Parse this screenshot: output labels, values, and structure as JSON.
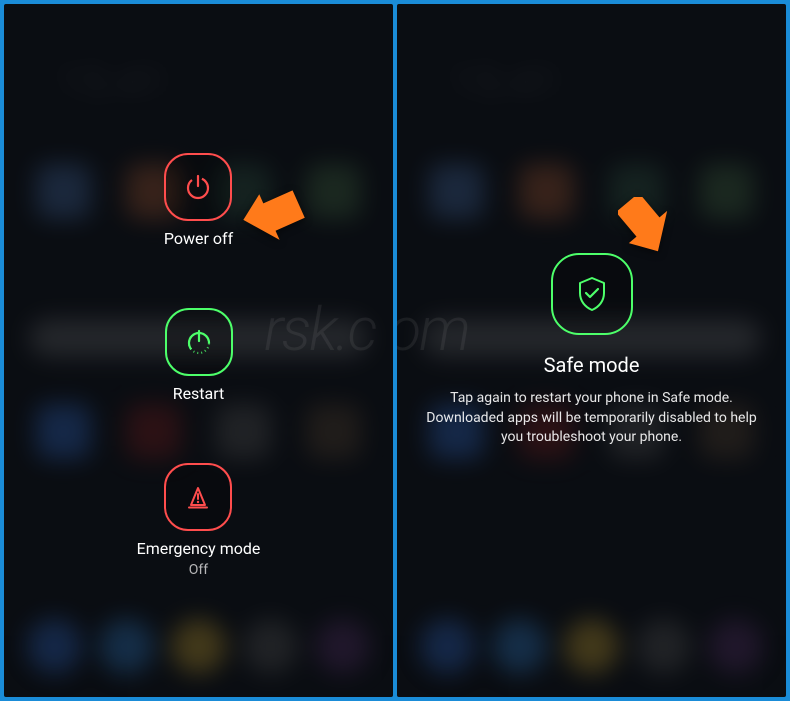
{
  "left_panel": {
    "power_off": {
      "label": "Power off"
    },
    "restart": {
      "label": "Restart"
    },
    "emergency": {
      "label": "Emergency mode",
      "status": "Off"
    }
  },
  "right_panel": {
    "safe_mode": {
      "title": "Safe mode",
      "description": "Tap again to restart your phone in Safe mode. Downloaded apps will be temporarily disabled to help you troubleshoot your phone."
    }
  },
  "colors": {
    "red": "#ff4d4d",
    "green": "#4dff6a",
    "arrow": "#ff7a1a"
  }
}
